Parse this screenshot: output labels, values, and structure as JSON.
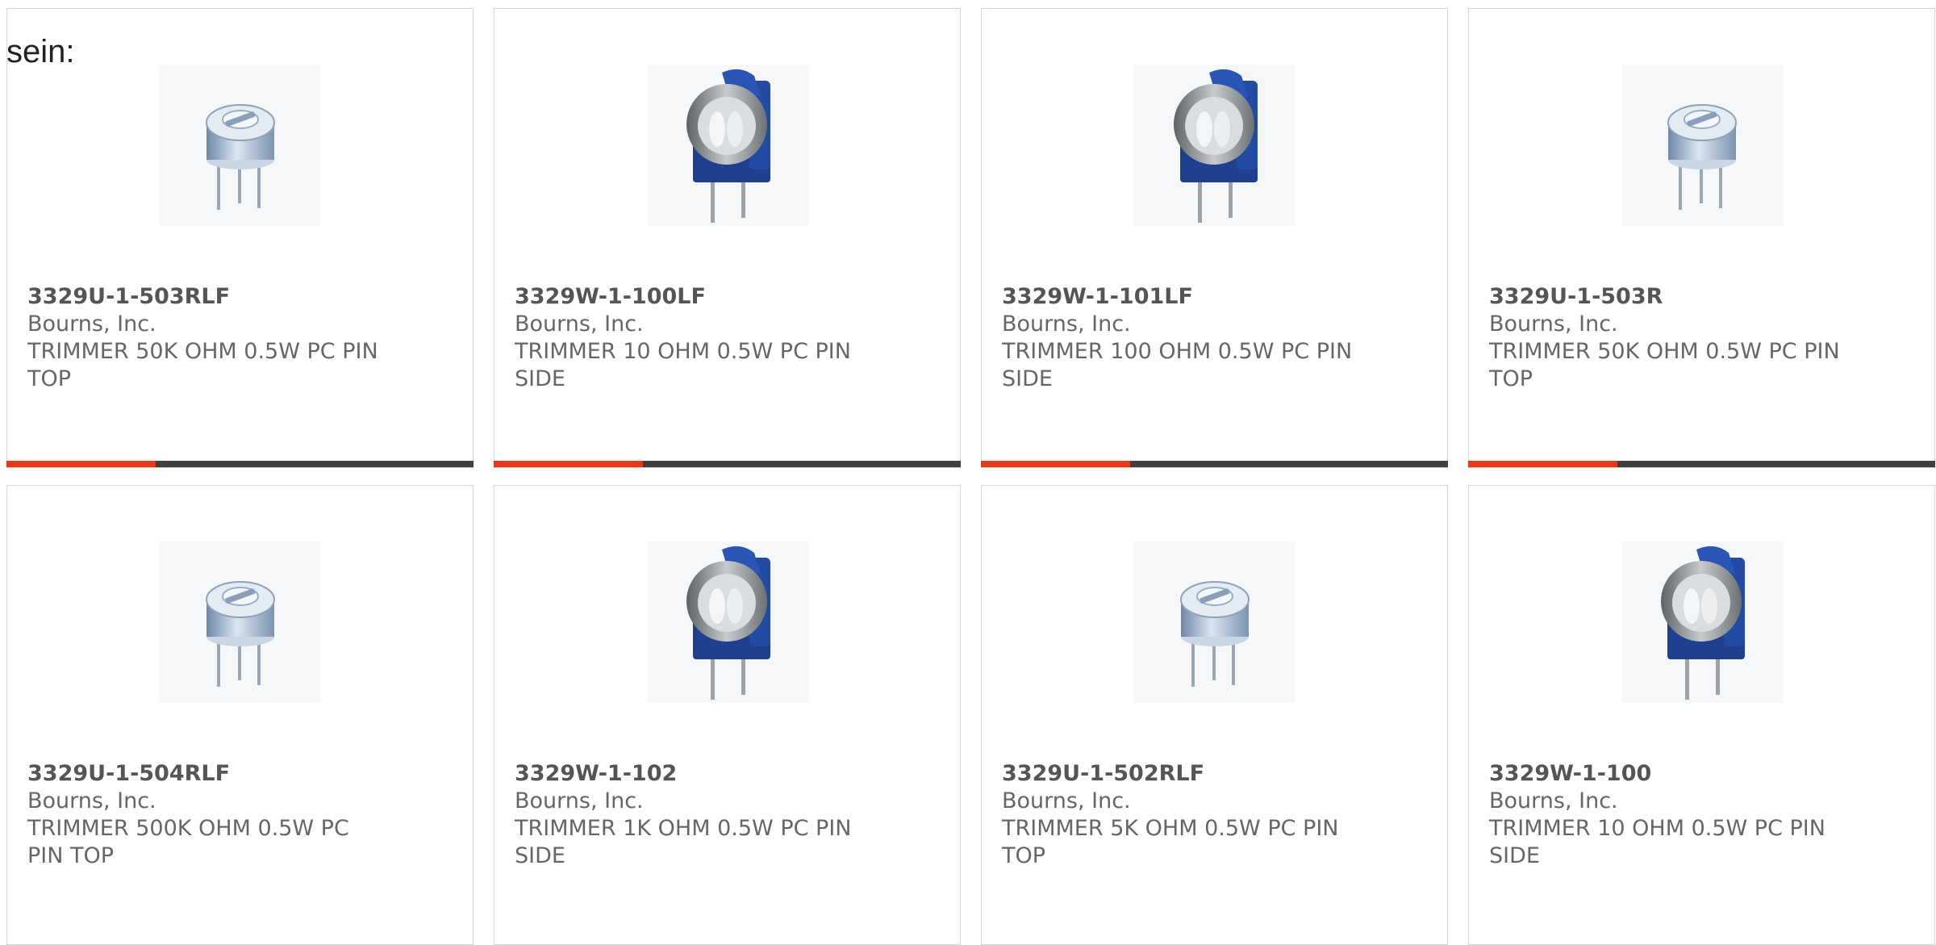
{
  "intro_text": "sein:",
  "colors": {
    "accent": "#e5391a",
    "bar": "#3f3f3f"
  },
  "products": [
    {
      "part_number": "3329U-1-503RLF",
      "manufacturer": "Bourns, Inc.",
      "description": "TRIMMER 50K OHM 0.5W PC PIN TOP",
      "image": "trimmer-top-adjust-icon",
      "progress": 0.32
    },
    {
      "part_number": "3329W-1-100LF",
      "manufacturer": "Bourns, Inc.",
      "description": "TRIMMER 10 OHM 0.5W PC PIN SIDE",
      "image": "trimmer-side-adjust-icon",
      "progress": 0.32
    },
    {
      "part_number": "3329W-1-101LF",
      "manufacturer": "Bourns, Inc.",
      "description": "TRIMMER 100 OHM 0.5W PC PIN SIDE",
      "image": "trimmer-side-adjust-icon",
      "progress": 0.32
    },
    {
      "part_number": "3329U-1-503R",
      "manufacturer": "Bourns, Inc.",
      "description": "TRIMMER 50K OHM 0.5W PC PIN TOP",
      "image": "trimmer-top-adjust-icon",
      "progress": 0.32
    },
    {
      "part_number": "3329U-1-504RLF",
      "manufacturer": "Bourns, Inc.",
      "description": "TRIMMER 500K OHM 0.5W PC PIN TOP",
      "image": "trimmer-top-adjust-icon",
      "progress": null
    },
    {
      "part_number": "3329W-1-102",
      "manufacturer": "Bourns, Inc.",
      "description": "TRIMMER 1K OHM 0.5W PC PIN SIDE",
      "image": "trimmer-side-adjust-icon",
      "progress": null
    },
    {
      "part_number": "3329U-1-502RLF",
      "manufacturer": "Bourns, Inc.",
      "description": "TRIMMER 5K OHM 0.5W PC PIN TOP",
      "image": "trimmer-top-adjust-icon",
      "progress": null
    },
    {
      "part_number": "3329W-1-100",
      "manufacturer": "Bourns, Inc.",
      "description": "TRIMMER 10 OHM 0.5W PC PIN SIDE",
      "image": "trimmer-side-adjust-icon",
      "progress": null
    }
  ]
}
